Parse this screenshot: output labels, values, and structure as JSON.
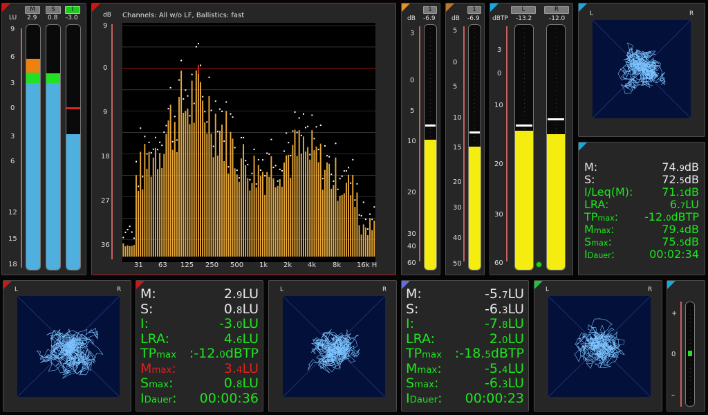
{
  "loudness_bars": {
    "unit": "LU",
    "buttons": [
      "M",
      "S",
      "I"
    ],
    "readouts": [
      "2.9",
      "0.8",
      "-3.0"
    ],
    "scale": [
      "9",
      "6",
      "3",
      "0",
      "3",
      "6",
      "12",
      "15",
      "18"
    ],
    "levels": {
      "M": 2.9,
      "S": 0.8,
      "I": -3.0
    }
  },
  "spectrum": {
    "title": "Channels: All w/o LF, Ballistics: fast",
    "unit": "dB",
    "y_ticks": [
      "9",
      "0",
      "9",
      "18",
      "27",
      "36"
    ],
    "x_ticks": [
      "31",
      "63",
      "125",
      "250",
      "500",
      "1k",
      "2k",
      "4k",
      "8k",
      "16k H"
    ]
  },
  "meter1": {
    "unit": "dB",
    "button": "1",
    "readout": "-6.9",
    "scale": [
      "3",
      "0",
      "5",
      "10",
      "20",
      "30",
      "40",
      "60"
    ]
  },
  "meter2": {
    "unit": "dB",
    "button": "1",
    "readout": "-6.9",
    "scale": [
      "5",
      "0",
      "5",
      "10",
      "15",
      "20",
      "30",
      "40",
      "50"
    ]
  },
  "truepeak": {
    "unit": "dBTP",
    "buttons": [
      "L",
      "R"
    ],
    "readouts": [
      "-13.2",
      "-12.0"
    ],
    "scale": [
      "3",
      "0",
      "10",
      "20",
      "30",
      "60"
    ]
  },
  "vectorscope_main": {
    "label_l": "L",
    "label_r": "R"
  },
  "readout_right": {
    "rows": [
      {
        "label": "M:",
        "num": "74.",
        "dec": "9",
        "unit": "dB"
      },
      {
        "label": "S:",
        "num": "72.",
        "dec": "5",
        "unit": "dB"
      },
      {
        "label": "I/Leq(M):",
        "num": "71.",
        "dec": "1",
        "unit": "dB"
      },
      {
        "label": "LRA:",
        "num": "6.",
        "dec": "7",
        "unit": "LU"
      },
      {
        "label": "TP",
        "sub": "max",
        "num": "-12.",
        "dec": "0",
        "unit": "dBTP"
      },
      {
        "label": "M",
        "sub": "max",
        "num": "79.",
        "dec": "4",
        "unit": "dB"
      },
      {
        "label": "S",
        "sub": "max",
        "num": "75.",
        "dec": "5",
        "unit": "dB"
      },
      {
        "label": "I",
        "sub": "Dauer",
        "num": "00:02:34",
        "dec": "",
        "unit": ""
      }
    ]
  },
  "readout_mid": {
    "rows": [
      {
        "label": "M:",
        "num": "2.",
        "dec": "9",
        "unit": "LU"
      },
      {
        "label": "S:",
        "num": "0.",
        "dec": "8",
        "unit": "LU"
      },
      {
        "label": "I:",
        "num": "-3.",
        "dec": "0",
        "unit": "LU"
      },
      {
        "label": "LRA:",
        "num": "4.",
        "dec": "6",
        "unit": "LU"
      },
      {
        "label": "TP",
        "sub": "max",
        "num": ":-12.",
        "dec": "0",
        "unit": "dBTP"
      },
      {
        "label": "M",
        "sub": "max",
        "num": "3.",
        "dec": "4",
        "unit": "LU"
      },
      {
        "label": "S",
        "sub": "max",
        "num": "0.",
        "dec": "8",
        "unit": "LU"
      },
      {
        "label": "I",
        "sub": "Dauer",
        "num": "00:00:36",
        "dec": "",
        "unit": ""
      }
    ]
  },
  "readout_mid2": {
    "rows": [
      {
        "label": "M:",
        "num": "-5.",
        "dec": "7",
        "unit": "LU"
      },
      {
        "label": "S:",
        "num": "-6.",
        "dec": "3",
        "unit": "LU"
      },
      {
        "label": "I:",
        "num": "-7.",
        "dec": "8",
        "unit": "LU"
      },
      {
        "label": "LRA:",
        "num": "2.",
        "dec": "0",
        "unit": "LU"
      },
      {
        "label": "TP",
        "sub": "max",
        "num": ":-18.",
        "dec": "5",
        "unit": "dBTP"
      },
      {
        "label": "M",
        "sub": "max",
        "num": "-5.",
        "dec": "4",
        "unit": "LU"
      },
      {
        "label": "S",
        "sub": "max",
        "num": "-6.",
        "dec": "3",
        "unit": "LU"
      },
      {
        "label": "I",
        "sub": "Dauer",
        "num": "00:00:23",
        "dec": "",
        "unit": ""
      }
    ]
  },
  "vectorscope_bl": {
    "label_l": "L",
    "label_r": "R"
  },
  "vectorscope_bm": {
    "label_l": "L",
    "label_r": "R"
  },
  "vectorscope_br": {
    "label_l": "L",
    "label_r": "R"
  },
  "balance": {
    "scale": [
      "+",
      "0",
      "–"
    ]
  },
  "colors": {
    "accent_red": "#c81818",
    "bar_blue": "#4fb0e0",
    "bar_yellow": "#f5ec10",
    "text_green": "#1ee61e",
    "text_white": "#e8e8e8",
    "spectrum_bar": "#e8a838",
    "scope_bg": "#02103a",
    "scope_trace": "#7cc4ff",
    "tri_orange": "#e0922a",
    "tri_brown": "#b87830",
    "tri_cyan": "#18a8e0",
    "tri_blue": "#6070e0",
    "tri_green": "#22c040"
  }
}
